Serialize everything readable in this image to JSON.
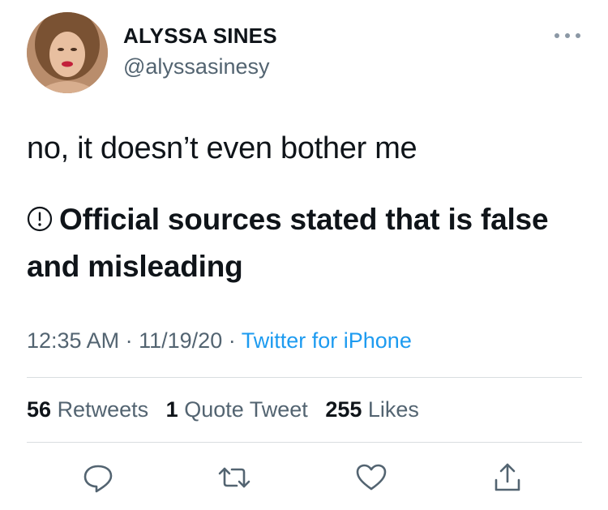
{
  "user": {
    "display_name": "ALYSSA SINES",
    "handle": "@alyssasinesy"
  },
  "tweet": {
    "text": "no, it doesn’t even bother me",
    "warning": "Official sources stated that is false and misleading"
  },
  "meta": {
    "time": "12:35 AM",
    "sep1": "·",
    "date": "11/19/20",
    "sep2": "·",
    "source": "Twitter for iPhone"
  },
  "stats": {
    "retweets_count": "56",
    "retweets_label": "Retweets",
    "quotes_count": "1",
    "quotes_label": "Quote Tweet",
    "likes_count": "255",
    "likes_label": "Likes"
  },
  "icons": {
    "reply": "reply-icon",
    "retweet": "retweet-icon",
    "like": "heart-icon",
    "share": "share-icon",
    "more": "more-dots-icon",
    "warning": "exclamation-circle-icon"
  },
  "colors": {
    "link": "#1d9bf0",
    "secondary_text": "#536471",
    "primary_text": "#0f1419"
  }
}
